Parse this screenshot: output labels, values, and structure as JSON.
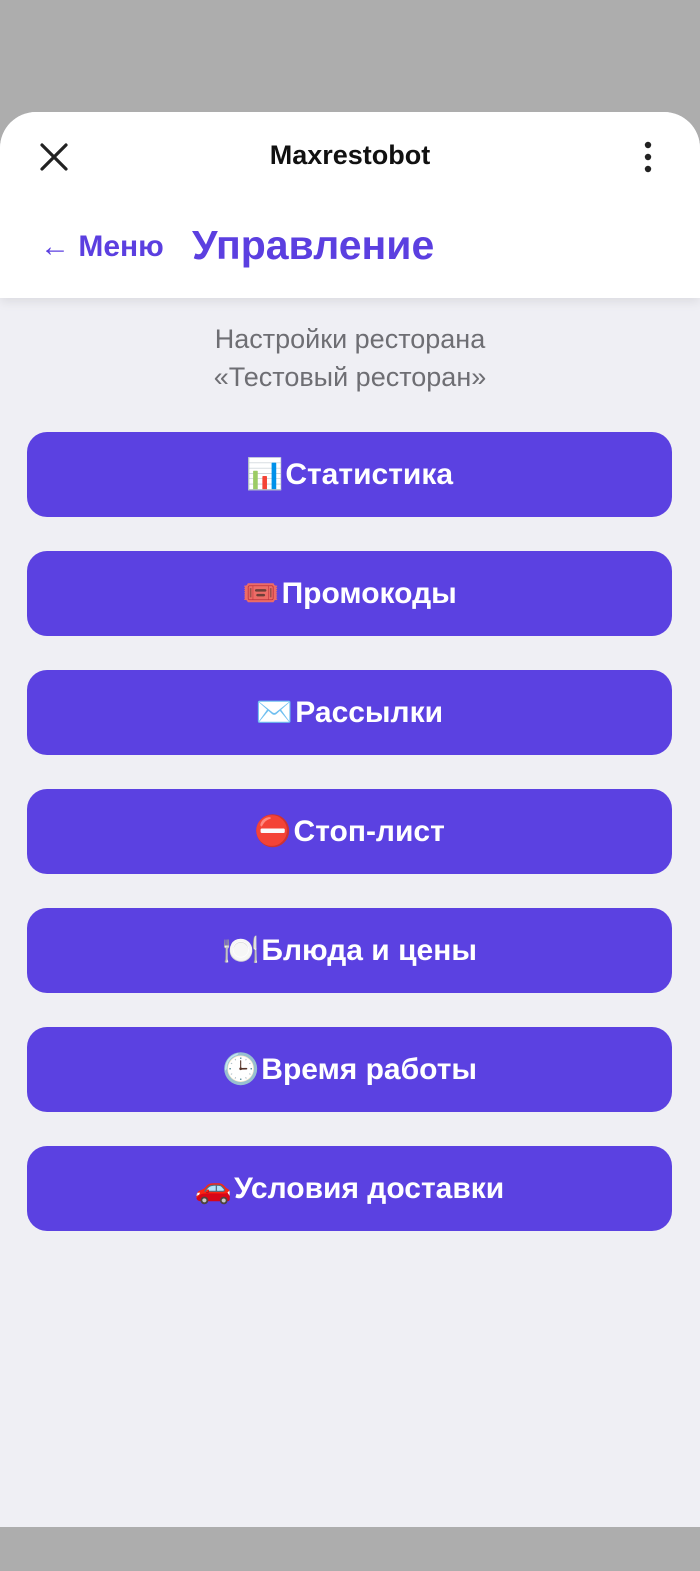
{
  "header": {
    "bot_name": "Maxrestobot",
    "back_label": "← Меню",
    "page_title": "Управление",
    "close_icon": "close-icon",
    "more_icon": "more-vertical-icon"
  },
  "subtitle": {
    "line1": "Настройки ресторана",
    "line2": "«Тестовый ресторан»"
  },
  "menu": {
    "items": [
      {
        "emoji": "📊",
        "label": "Статистика"
      },
      {
        "emoji": "🎟️",
        "label": "Промокоды"
      },
      {
        "emoji": "✉️",
        "label": "Рассылки"
      },
      {
        "emoji": "⛔",
        "label": "Стоп-лист"
      },
      {
        "emoji": "🍽️",
        "label": "Блюда и цены"
      },
      {
        "emoji": "🕒",
        "label": "Время работы"
      },
      {
        "emoji": "🚗",
        "label": "Условия доставки"
      }
    ]
  },
  "colors": {
    "accent": "#5b41e1",
    "background": "#efeff4",
    "overlay": "#adadad"
  }
}
